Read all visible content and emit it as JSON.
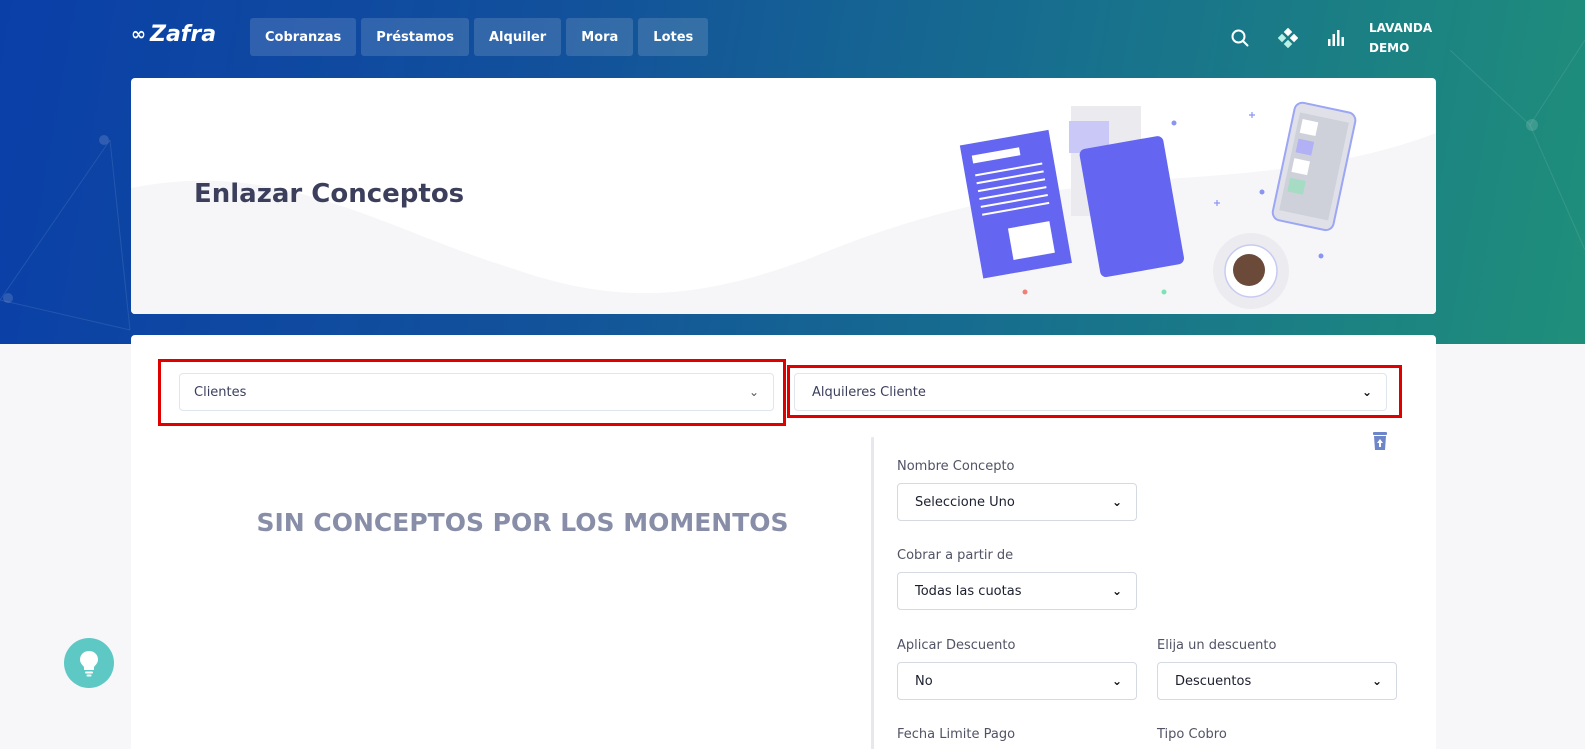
{
  "brand": {
    "name": "Zafra",
    "logo_glyph": "∞"
  },
  "nav": [
    {
      "label": "Cobranzas"
    },
    {
      "label": "Préstamos"
    },
    {
      "label": "Alquiler"
    },
    {
      "label": "Mora"
    },
    {
      "label": "Lotes"
    }
  ],
  "header_icons": [
    "search-icon",
    "apps-icon",
    "bar-chart-icon"
  ],
  "user": {
    "line1": "LAVANDA",
    "line2": "DEMO"
  },
  "hero": {
    "title": "Enlazar Conceptos"
  },
  "filters": {
    "entity_select": {
      "value": "Clientes"
    },
    "type_select": {
      "value": "Alquileres Cliente"
    }
  },
  "empty_message": "SIN CONCEPTOS POR LOS MOMENTOS",
  "form": {
    "nombre_concepto": {
      "label": "Nombre Concepto",
      "value": "Seleccione Uno"
    },
    "cobrar_a_partir": {
      "label": "Cobrar a partir de",
      "value": "Todas las cuotas"
    },
    "aplicar_descuento": {
      "label": "Aplicar Descuento",
      "value": "No"
    },
    "elija_descuento": {
      "label": "Elija un descuento",
      "value": "Descuentos"
    },
    "fecha_limite": {
      "label": "Fecha Limite Pago"
    },
    "tipo_cobro": {
      "label": "Tipo Cobro"
    }
  },
  "colors": {
    "highlight": "#e00000",
    "accent": "#6466f1",
    "help": "#5ec9c4"
  }
}
